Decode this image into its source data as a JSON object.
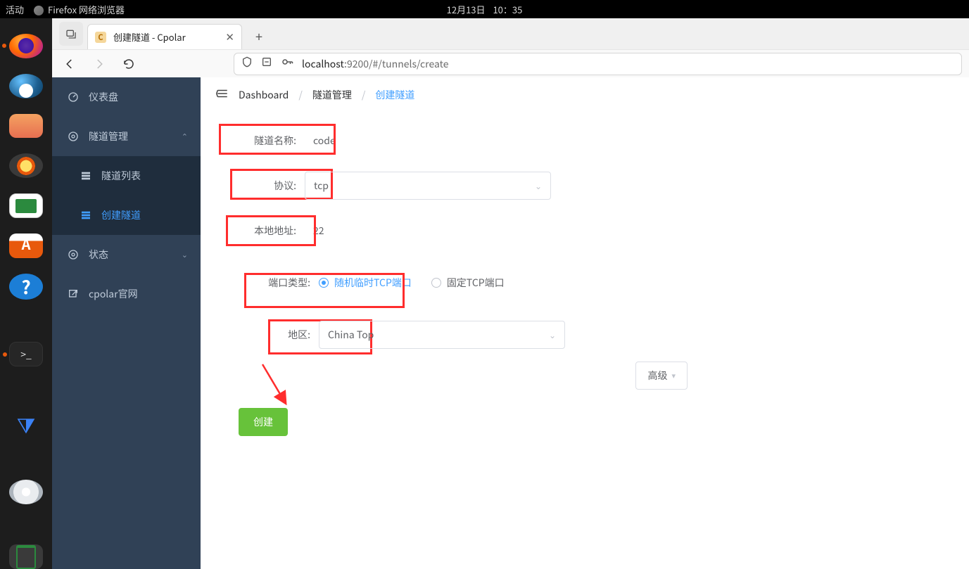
{
  "gnome": {
    "activities": "活动",
    "app_title": "Firefox 网络浏览器",
    "date": "12月13日",
    "time": "10：35"
  },
  "firefox": {
    "tab_title": "创建隧道 - Cpolar",
    "favicon_letter": "C",
    "url_host": "localhost",
    "url_path": ":9200/#/tunnels/create"
  },
  "sidebar": {
    "dashboard": "仪表盘",
    "tunnel_mgmt": "隧道管理",
    "tunnel_list": "隧道列表",
    "tunnel_create": "创建隧道",
    "status": "状态",
    "official": "cpolar官网"
  },
  "breadcrumb": {
    "b1": "Dashboard",
    "b2": "隧道管理",
    "b3": "创建隧道"
  },
  "form": {
    "name_label": "隧道名称:",
    "name_value": "code",
    "proto_label": "协议:",
    "proto_value": "tcp",
    "addr_label": "本地地址:",
    "addr_value": "22",
    "port_type_label": "端口类型:",
    "port_type_random": "随机临时TCP端口",
    "port_type_fixed": "固定TCP端口",
    "region_label": "地区:",
    "region_value": "China Top",
    "advanced": "高级",
    "create": "创建"
  }
}
